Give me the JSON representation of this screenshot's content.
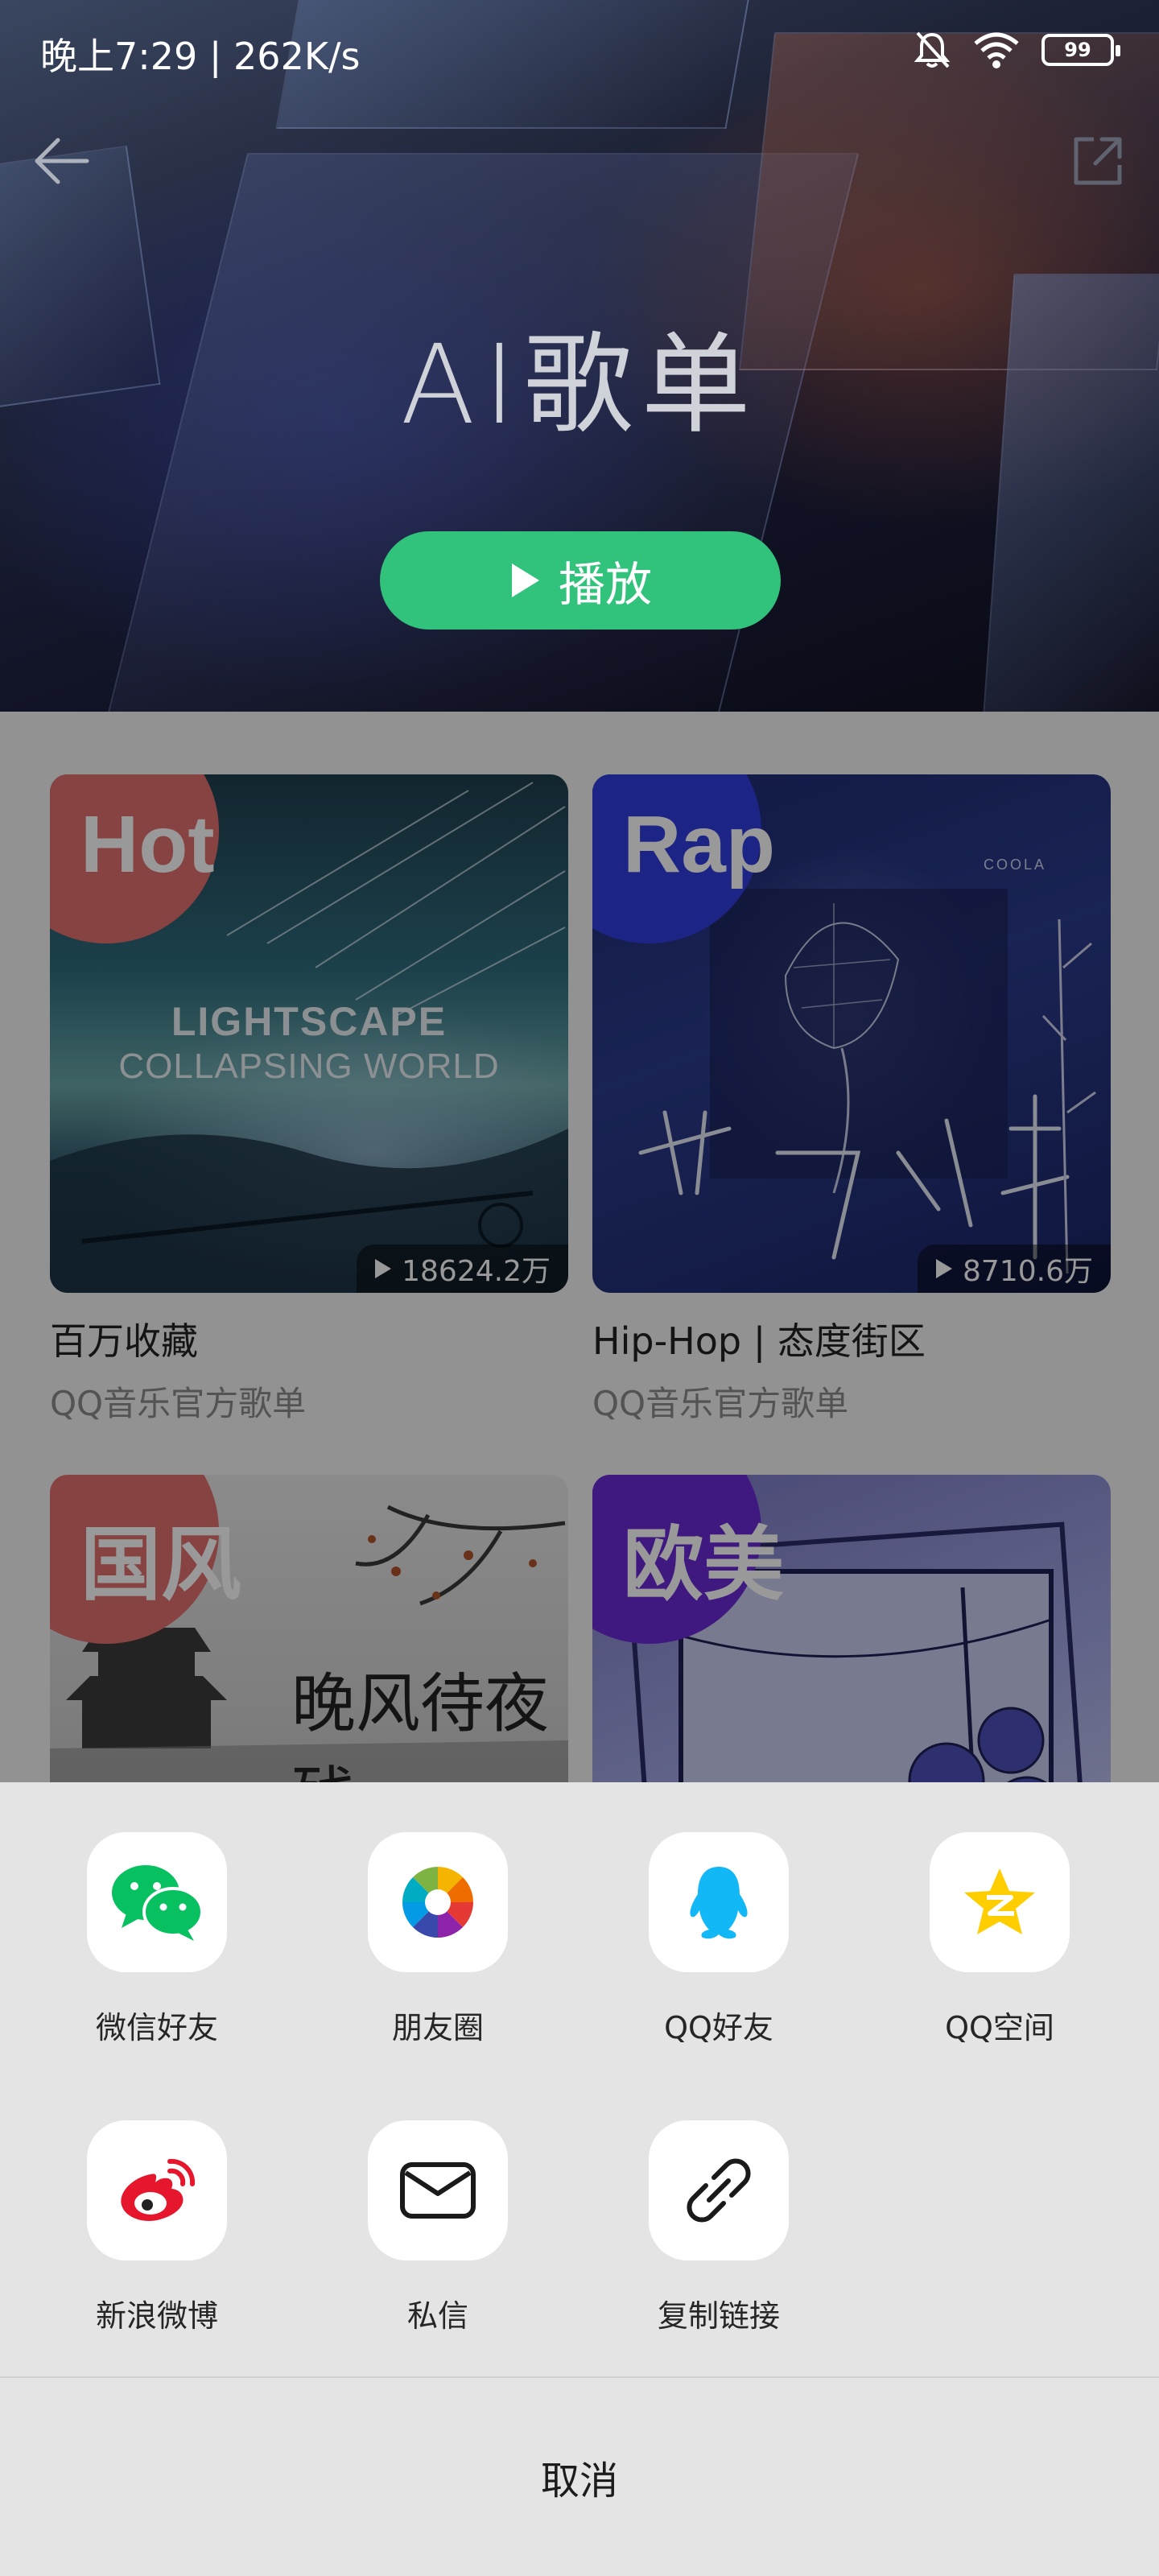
{
  "status_bar": {
    "time": "晚上7:29 | 262K/s",
    "battery": "99"
  },
  "header": {
    "title": "AI歌单",
    "play_label": "播放"
  },
  "playlists": [
    {
      "badge": "Hot",
      "badge_color": "#e26f6f",
      "plays": "18624.2万",
      "title": "百万收藏",
      "subtitle": "QQ音乐官方歌单",
      "cover_text": [
        "LIGHTSCAPE",
        "COLLAPSING WORLD"
      ]
    },
    {
      "badge": "Rap",
      "badge_color": "#2f3de0",
      "plays": "8710.6万",
      "title": "Hip-Hop | 态度街区",
      "subtitle": "QQ音乐官方歌单",
      "cover_text": [
        "COOLA"
      ]
    },
    {
      "badge": "国风",
      "badge_color": "#e26f6f",
      "cover_text": [
        "晚风待夜残"
      ]
    },
    {
      "badge": "欧美",
      "badge_color": "#6a2bd6"
    }
  ],
  "share_sheet": {
    "items": [
      {
        "label": "微信好友",
        "icon": "wechat-icon",
        "color": "#07c160"
      },
      {
        "label": "朋友圈",
        "icon": "moments-icon"
      },
      {
        "label": "QQ好友",
        "icon": "qq-icon",
        "color": "#12b7f5"
      },
      {
        "label": "QQ空间",
        "icon": "qzone-icon",
        "color": "#ffce00"
      },
      {
        "label": "新浪微博",
        "icon": "weibo-icon",
        "color": "#e6162d"
      },
      {
        "label": "私信",
        "icon": "mail-icon"
      },
      {
        "label": "复制链接",
        "icon": "link-icon"
      }
    ],
    "cancel_label": "取消"
  }
}
